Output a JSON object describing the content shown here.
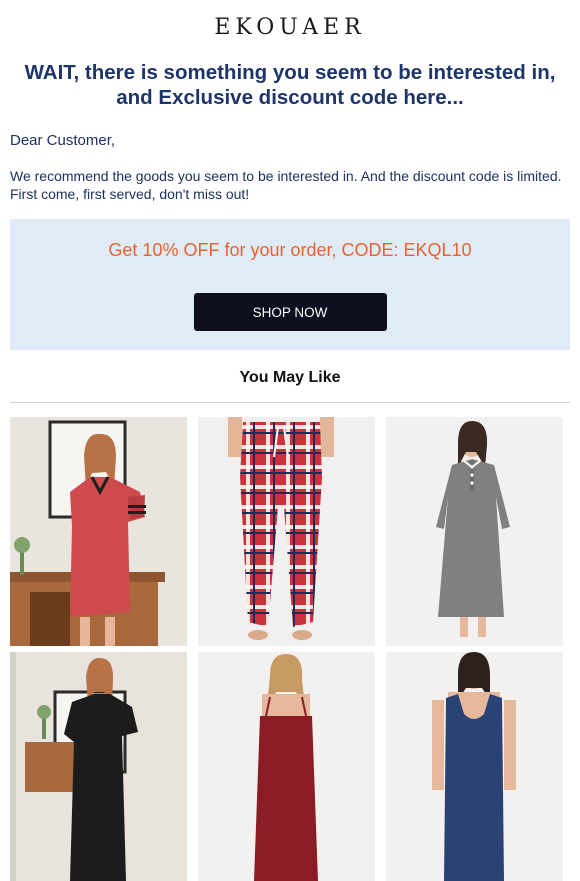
{
  "brand": {
    "logo": "EKOUAER"
  },
  "headline": "WAIT, there is something you seem to be interested in, and Exclusive discount code here...",
  "greeting": "Dear Customer,",
  "intro": "We recommend the goods you seem to be interested in. And the discount code is limited. First come, first served, don't miss out!",
  "promo": {
    "text": "Get 10% OFF for your order, CODE: EKQL10",
    "button_label": "SHOP NOW"
  },
  "section_title": "You May Like",
  "colors": {
    "headline": "#1d3568",
    "promo_text": "#e8632b",
    "promo_bg": "#e1eaf7",
    "button_bg": "#0e0f1e"
  }
}
